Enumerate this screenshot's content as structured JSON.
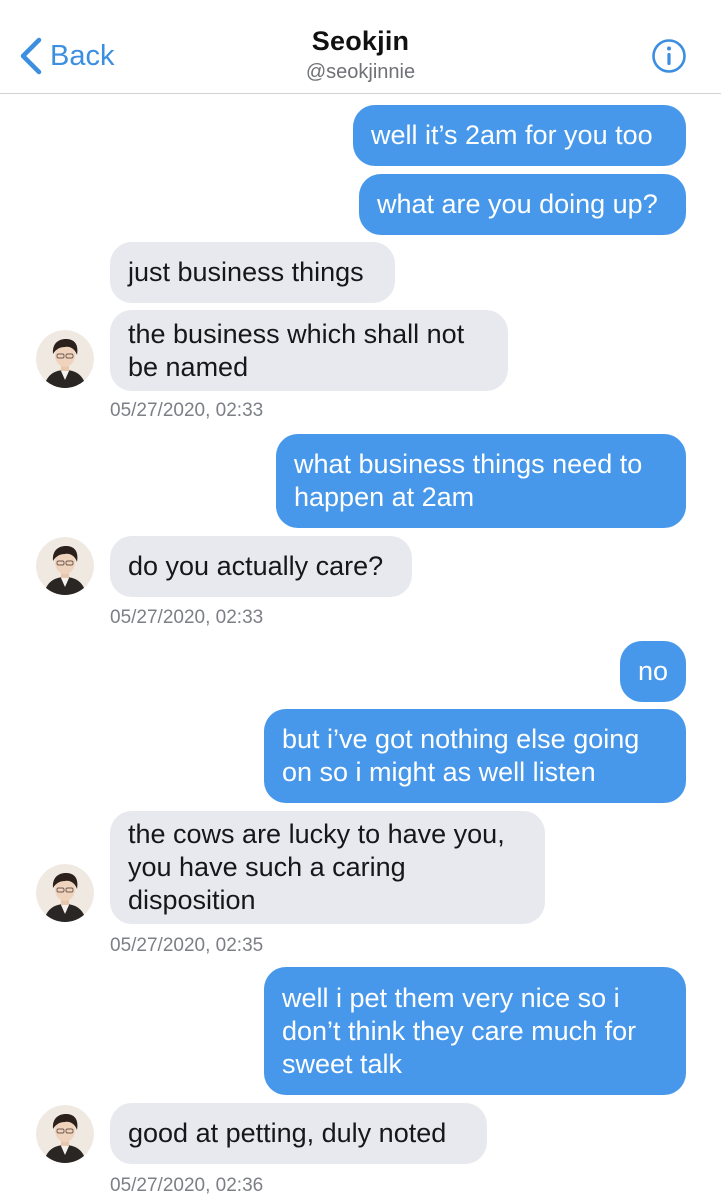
{
  "header": {
    "back_label": "Back",
    "contact_name": "Seokjin",
    "contact_handle": "@seokjinnie",
    "info_icon": "info-circle-icon",
    "accent_color": "#3b8ee0"
  },
  "colors": {
    "sent_bubble": "#4798ea",
    "received_bubble": "#e7e9ee"
  },
  "messages": [
    {
      "from": "me",
      "lines": [
        "well it’s 2am for you too"
      ]
    },
    {
      "from": "me",
      "lines": [
        "what are you doing up?"
      ]
    },
    {
      "from": "them",
      "lines": [
        "just business things"
      ]
    },
    {
      "from": "them",
      "lines": [
        "the business which shall not",
        "be named"
      ]
    },
    {
      "from": "me",
      "lines": [
        "what business things need to",
        "happen at 2am"
      ]
    },
    {
      "from": "them",
      "lines": [
        "do you actually care?"
      ]
    },
    {
      "from": "me",
      "lines": [
        "no"
      ]
    },
    {
      "from": "me",
      "lines": [
        "but i’ve got nothing else going",
        "on so i might as well listen"
      ]
    },
    {
      "from": "them",
      "lines": [
        "the cows are lucky to have you,",
        "you have such a caring",
        "disposition"
      ]
    },
    {
      "from": "me",
      "lines": [
        "well i pet them very nice so i",
        "don’t think they care much for",
        "sweet talk"
      ]
    },
    {
      "from": "them",
      "lines": [
        "good at petting, duly noted"
      ]
    }
  ],
  "timestamps": [
    "05/27/2020, 02:33",
    "05/27/2020, 02:33",
    "05/27/2020, 02:35",
    "05/27/2020, 02:36"
  ]
}
